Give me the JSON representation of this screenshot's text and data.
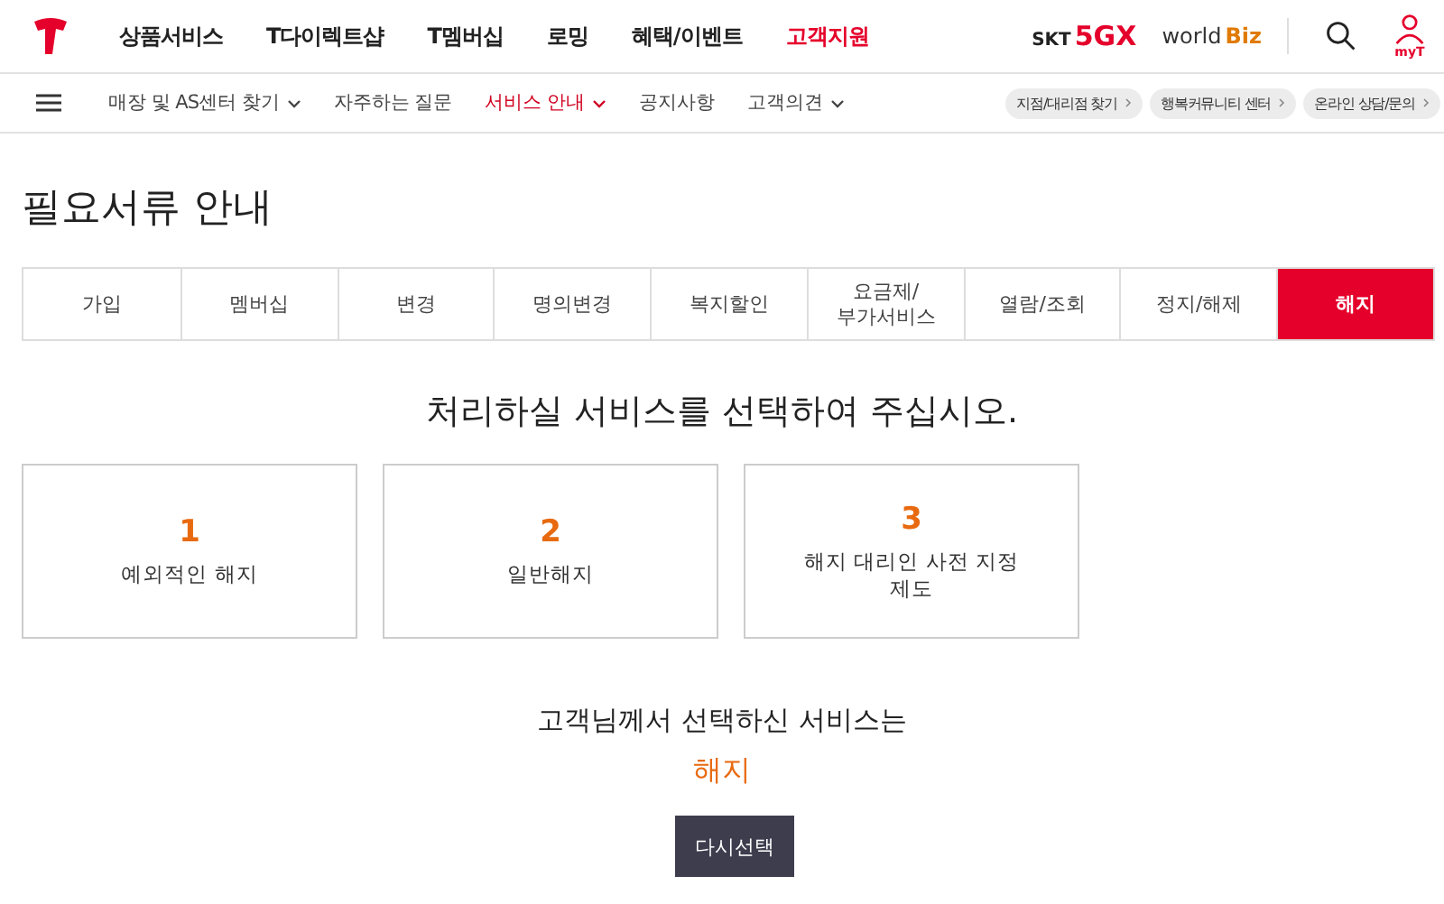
{
  "top_nav": {
    "items": [
      {
        "label": "상품서비스",
        "selected": false
      },
      {
        "label": "T다이렉트샵",
        "selected": false
      },
      {
        "label": "T멤버십",
        "selected": false
      },
      {
        "label": "로밍",
        "selected": false
      },
      {
        "label": "혜택/이벤트",
        "selected": false
      },
      {
        "label": "고객지원",
        "selected": true
      }
    ],
    "brand_links": [
      {
        "prefix": "SKT",
        "main": "5GX"
      },
      {
        "prefix": "world",
        "main": "Biz"
      }
    ],
    "user_label": "myT"
  },
  "sub_nav": {
    "items": [
      {
        "label": "매장 및 AS센터 찾기",
        "selected": false,
        "dropdown": true
      },
      {
        "label": "자주하는 질문",
        "selected": false,
        "dropdown": false
      },
      {
        "label": "서비스 안내",
        "selected": true,
        "dropdown": true
      },
      {
        "label": "공지사항",
        "selected": false,
        "dropdown": false
      },
      {
        "label": "고객의견",
        "selected": false,
        "dropdown": true
      }
    ],
    "pills": [
      "지점/대리점 찾기",
      "행복커뮤니티 센터",
      "온라인 상담/문의"
    ]
  },
  "page_title": "필요서류 안내",
  "tabs": [
    {
      "label": "가입",
      "selected": false
    },
    {
      "label": "멤버십",
      "selected": false
    },
    {
      "label": "변경",
      "selected": false
    },
    {
      "label": "명의변경",
      "selected": false
    },
    {
      "label": "복지할인",
      "selected": false
    },
    {
      "label": "요금제/\n부가서비스",
      "selected": false
    },
    {
      "label": "열람/조회",
      "selected": false
    },
    {
      "label": "정지/해제",
      "selected": false
    },
    {
      "label": "해지",
      "selected": true
    }
  ],
  "prompt": "처리하실 서비스를 선택하여 주십시오.",
  "options": [
    {
      "number": "1",
      "label": "예외적인 해지"
    },
    {
      "number": "2",
      "label": "일반해지"
    },
    {
      "number": "3",
      "label": "해지 대리인 사전 지정\n제도"
    }
  ],
  "result_caption": "고객님께서 선택하신 서비스는",
  "result_value": "해지",
  "reselect_button": "다시선택"
}
